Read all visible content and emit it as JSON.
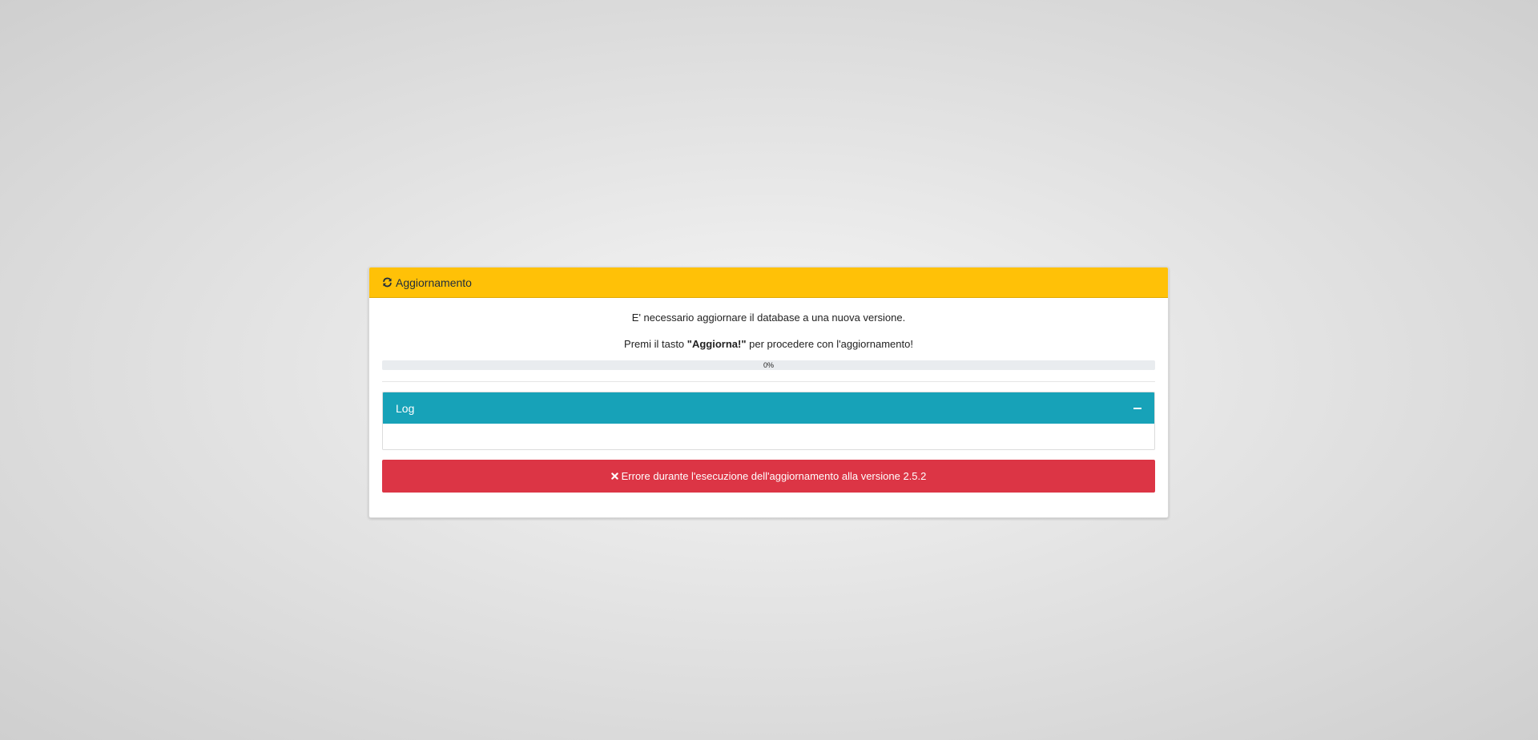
{
  "card": {
    "title": "Aggiornamento",
    "title_icon": "refresh-icon",
    "accent_color": "#ffc107"
  },
  "message": {
    "line1": "E' necessario aggiornare il database a una nuova versione.",
    "line2_before": "Premi il tasto ",
    "line2_bold": "\"Aggiorna!\"",
    "line2_after": " per procedere con l'aggiornamento!"
  },
  "progress": {
    "value": 0,
    "label": "0%"
  },
  "log": {
    "title": "Log",
    "collapse_icon": "minus-icon",
    "header_color": "#17a2b8",
    "content": ""
  },
  "error": {
    "icon": "close-icon",
    "text": "Errore durante l'esecuzione dell'aggiornamento alla versione 2.5.2",
    "color": "#dc3545"
  }
}
